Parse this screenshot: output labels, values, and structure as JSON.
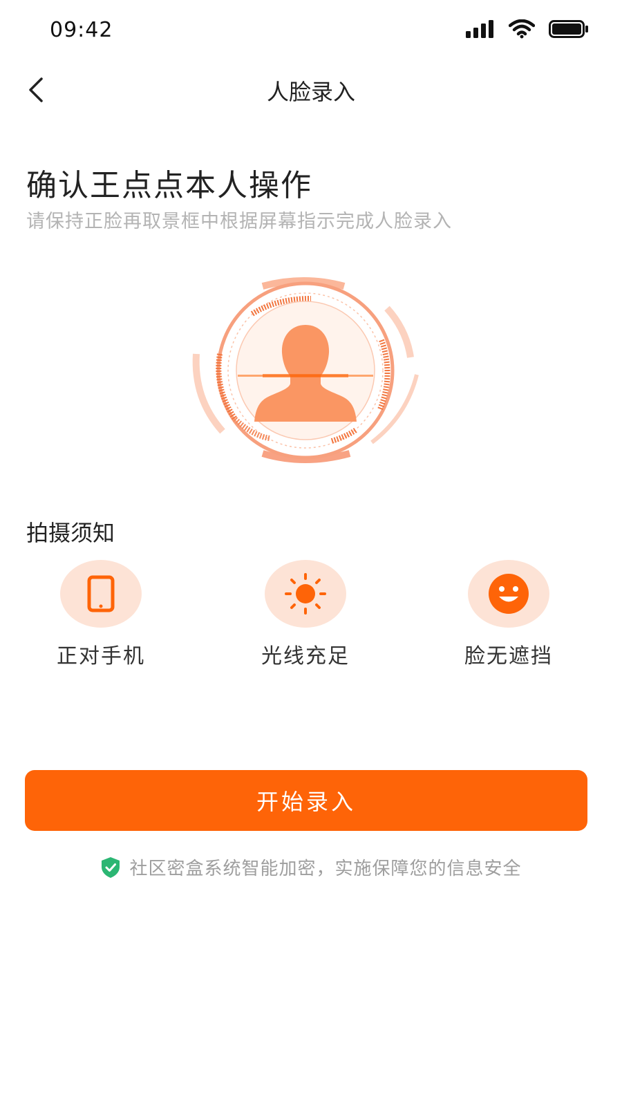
{
  "status_bar": {
    "time": "09:42",
    "icons": [
      "signal-icon",
      "wifi-icon",
      "battery-icon"
    ]
  },
  "nav": {
    "back_icon": "chevron-left-icon",
    "title": "人脸录入"
  },
  "header": {
    "heading": "确认王点点本人操作",
    "subtitle": "请保持正脸再取景框中根据屏幕指示完成人脸录入"
  },
  "face_graphic": {
    "icon": "face-scan-frame-icon"
  },
  "notice": {
    "title": "拍摄须知",
    "tips": [
      {
        "icon": "phone-icon",
        "label": "正对手机"
      },
      {
        "icon": "sun-icon",
        "label": "光线充足"
      },
      {
        "icon": "smile-icon",
        "label": "脸无遮挡"
      }
    ]
  },
  "action": {
    "start_label": "开始录入"
  },
  "security": {
    "icon": "shield-check-icon",
    "text": "社区密盒系统智能加密，实施保障您的信息安全"
  },
  "colors": {
    "accent": "#fe6408",
    "accent_light": "#fde3d6",
    "muted_text": "#b3b3b3",
    "shield_green": "#2bb673"
  }
}
